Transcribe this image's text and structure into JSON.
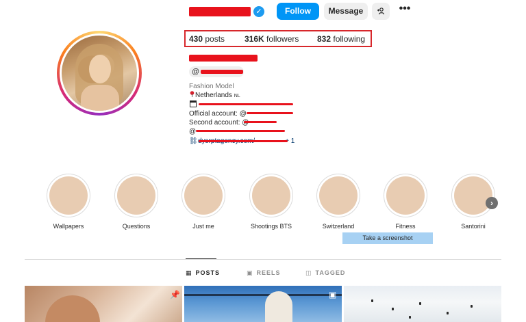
{
  "header": {
    "follow_label": "Follow",
    "message_label": "Message",
    "add_user_icon": "⁺👤",
    "more_icon": "•••",
    "verified_mark": "✓"
  },
  "stats": {
    "posts_count": "430",
    "posts_label": " posts",
    "followers_count": "316K",
    "followers_label": " followers",
    "following_count": "832",
    "following_label": " following"
  },
  "bio": {
    "category": "Fashion Model",
    "location": "Netherlands",
    "country_code": "NL",
    "official_label": "Official account: @",
    "second_label": "Second account: @",
    "at_sign": "@",
    "link_text": "dysrptagency.com/",
    "link_extra": "+ 1"
  },
  "highlights": [
    {
      "label": "Wallpapers"
    },
    {
      "label": "Questions"
    },
    {
      "label": "Just me"
    },
    {
      "label": "Shootings BTS"
    },
    {
      "label": "Switzerland"
    },
    {
      "label": "Fitness"
    },
    {
      "label": "Santorini"
    }
  ],
  "tooltip": "Take a screenshot",
  "tabs": [
    {
      "label": "POSTS",
      "icon": "▦"
    },
    {
      "label": "REELS",
      "icon": "▣"
    },
    {
      "label": "TAGGED",
      "icon": "◫"
    }
  ],
  "colors": {
    "follow_blue": "#0095f6",
    "highlight_box": "#d7272b",
    "redaction": "#e8121c"
  }
}
